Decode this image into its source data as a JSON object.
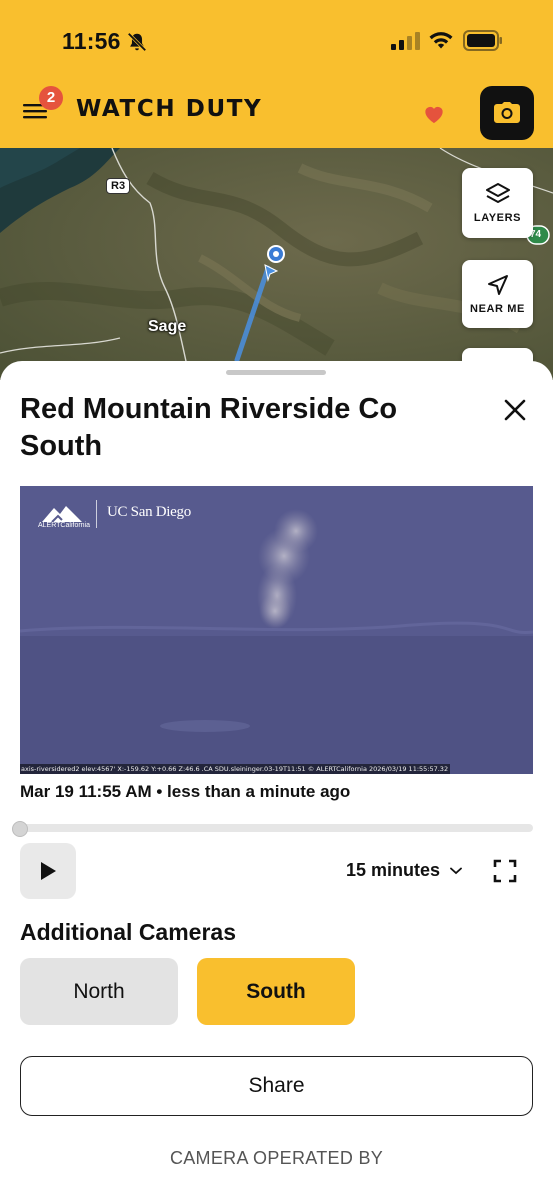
{
  "status_bar": {
    "time": "11:56",
    "icons": [
      "bell-slash-icon",
      "cellular-signal-icon",
      "wifi-icon",
      "battery-icon"
    ]
  },
  "header": {
    "app_name": "WATCH DUTY",
    "menu_badge_count": "2",
    "icons": [
      "hamburger-menu-icon",
      "heart-icon",
      "camera-icon"
    ],
    "accent_color": "#f9bf2e"
  },
  "map": {
    "labels": {
      "place": "Sage",
      "route": "R3",
      "route_right": "74"
    },
    "controls": {
      "layers_label": "LAYERS",
      "near_me_label": "NEAR ME"
    }
  },
  "camera_sheet": {
    "title": "Red Mountain Riverside Co South",
    "feed": {
      "caption": "axis-riversidered2 elev:4567' X:-159.62 Y:+0.66 Z:46.6 .CA SDU.sleininger.03-19T11:51 © ALERTCalifornia 2026/03/19 11:55:57.32",
      "logo_left": "ALERTCalifornia",
      "logo_right": "UC San Diego"
    },
    "timestamp": "Mar 19 11:55 AM • less than a minute ago",
    "playback": {
      "progress": 0.0,
      "duration_label": "15 minutes"
    },
    "additional_cameras": {
      "heading": "Additional Cameras",
      "options": [
        {
          "label": "North",
          "selected": false
        },
        {
          "label": "South",
          "selected": true
        }
      ]
    },
    "share_label": "Share",
    "operated_by_label": "CAMERA OPERATED BY"
  }
}
